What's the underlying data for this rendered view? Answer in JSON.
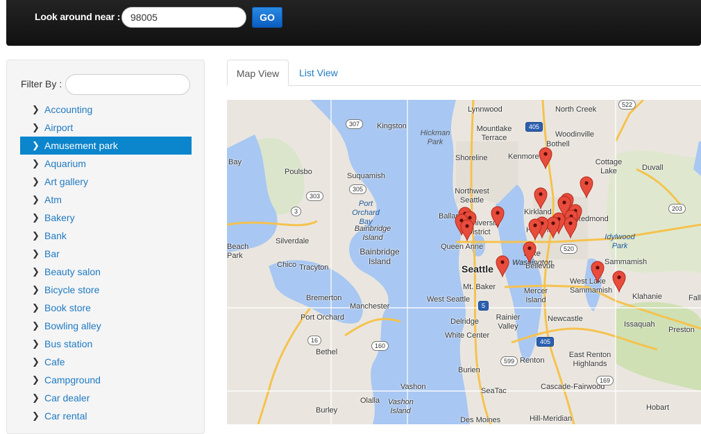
{
  "search": {
    "label": "Look around near :",
    "value": "98005",
    "go_label": "GO"
  },
  "sidebar": {
    "filter_label": "Filter By :",
    "filter_value": "",
    "selected": "Amusement park",
    "categories": [
      "Accounting",
      "Airport",
      "Amusement park",
      "Aquarium",
      "Art gallery",
      "Atm",
      "Bakery",
      "Bank",
      "Bar",
      "Beauty salon",
      "Bicycle store",
      "Book store",
      "Bowling alley",
      "Bus station",
      "Cafe",
      "Campground",
      "Car dealer",
      "Car rental"
    ]
  },
  "tabs": {
    "map": "Map View",
    "list": "List View"
  },
  "map": {
    "places": [
      "Lynnwood",
      "North Creek",
      "Kingston",
      "Mountlake Terrace",
      "Hickman Park",
      "Bothell",
      "Woodinville",
      "Shoreline",
      "Kenmore",
      "Cottage Lake",
      "Duvall",
      "Bay",
      "Poulsbo",
      "Suquamish",
      "Northwest Seattle",
      "Kirkland",
      "Redmond",
      "Ballard",
      "University District",
      "Houghton",
      "Port Orchard Bay",
      "Bainbridge Island",
      "Bainbridge Island",
      "Silverdale",
      "Queen Anne",
      "Lake Washington",
      "Idylwood Park",
      "Beach Park",
      "Seattle",
      "Bellevue",
      "Sammamish",
      "Chico",
      "Tracyton",
      "Mt. Baker",
      "West Lake Sammamish",
      "Bremerton",
      "Manchester",
      "West Seattle",
      "Mercer Island",
      "Klahanie",
      "Falls",
      "Port Orchard",
      "Delridge",
      "Rainier Valley",
      "Newcastle",
      "Issaquah",
      "White Center",
      "Preston",
      "Bethel",
      "Burien",
      "Renton",
      "East Renton Highlands",
      "Vashon",
      "SeaTac",
      "Cascade-Fairwood",
      "Olalla",
      "Vashon Island",
      "Des Moines",
      "Hill-Meridian",
      "Hobart",
      "Burley"
    ],
    "route_shields": [
      "522",
      "307",
      "405",
      "303",
      "305",
      "3",
      "520",
      "203",
      "5",
      "16",
      "160",
      "405",
      "599",
      "169"
    ],
    "marker_count": 21
  },
  "colors": {
    "topbar": "#1a1a1a",
    "accent": "#0b85cc",
    "link": "#1f7ac2",
    "water": "#a8c7f2",
    "land": "#eae6df",
    "park": "#c8dea6",
    "road": "#f5c24e",
    "marker": "#e74c3c"
  }
}
